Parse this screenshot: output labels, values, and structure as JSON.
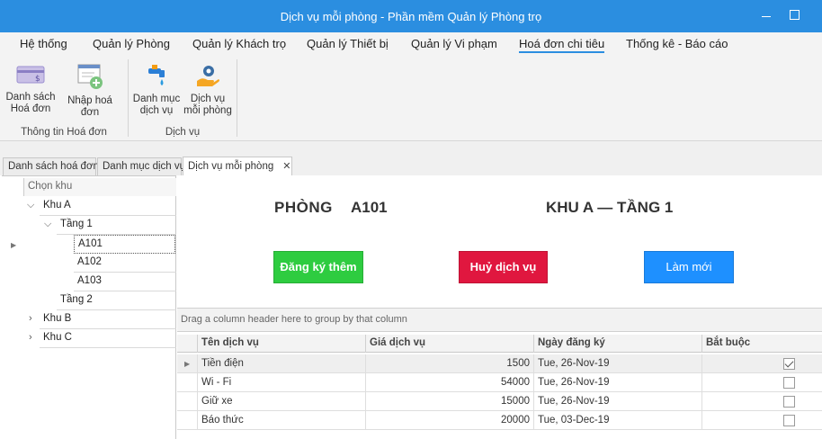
{
  "window": {
    "title": "Dịch vụ mỗi phòng - Phần mềm Quản lý Phòng trọ"
  },
  "menu": [
    {
      "label": "Hệ thống"
    },
    {
      "label": "Quản lý Phòng"
    },
    {
      "label": "Quản lý Khách trọ"
    },
    {
      "label": "Quản lý Thiết bị"
    },
    {
      "label": "Quản lý Vi phạm"
    },
    {
      "label": "Hoá đơn chi tiêu"
    },
    {
      "label": "Thống kê - Báo cáo"
    }
  ],
  "ribbon": {
    "invoice_list": "Danh sách\nHoá đơn",
    "invoice_add": "Nhập hoá đơn",
    "group_invoice": "Thông tin Hoá đơn",
    "service_catalog": "Danh mục\ndịch vụ",
    "room_services": "Dịch vụ\nmỗi phòng",
    "group_service": "Dịch vụ"
  },
  "doc_tabs": [
    {
      "label": "Danh sách hoá đơn"
    },
    {
      "label": "Danh mục dịch vụ"
    },
    {
      "label": "Dịch vụ mỗi phòng"
    }
  ],
  "tree": {
    "header": "Chọn khu",
    "nodes": [
      {
        "label": "Khu A"
      },
      {
        "label": "Tầng 1"
      },
      {
        "label": "A101"
      },
      {
        "label": "A102"
      },
      {
        "label": "A103"
      },
      {
        "label": "Tầng 2"
      },
      {
        "label": "Khu B"
      },
      {
        "label": "Khu C"
      }
    ]
  },
  "room": {
    "label": "PHÒNG",
    "value": "A101",
    "area": "KHU A — TẦNG 1"
  },
  "buttons": {
    "register": "Đăng ký thêm",
    "cancel": "Huỷ dịch vụ",
    "refresh": "Làm mới"
  },
  "grid": {
    "group_hint": "Drag a column header here to group by that column",
    "columns": [
      "Tên dịch vụ",
      "Giá dịch vụ",
      "Ngày đăng ký",
      "Bắt buộc"
    ],
    "rows": [
      {
        "name": "Tiền điện",
        "price": "1500",
        "date": "Tue, 26-Nov-19",
        "required": true
      },
      {
        "name": "Wi - Fi",
        "price": "54000",
        "date": "Tue, 26-Nov-19",
        "required": false
      },
      {
        "name": "Giữ xe",
        "price": "15000",
        "date": "Tue, 26-Nov-19",
        "required": false
      },
      {
        "name": "Báo thức",
        "price": "20000",
        "date": "Tue, 03-Dec-19",
        "required": false
      }
    ]
  },
  "colors": {
    "accent": "#2b8ee0",
    "register": "#2ecc40",
    "cancel": "#e0173f",
    "refresh": "#1e90ff"
  }
}
